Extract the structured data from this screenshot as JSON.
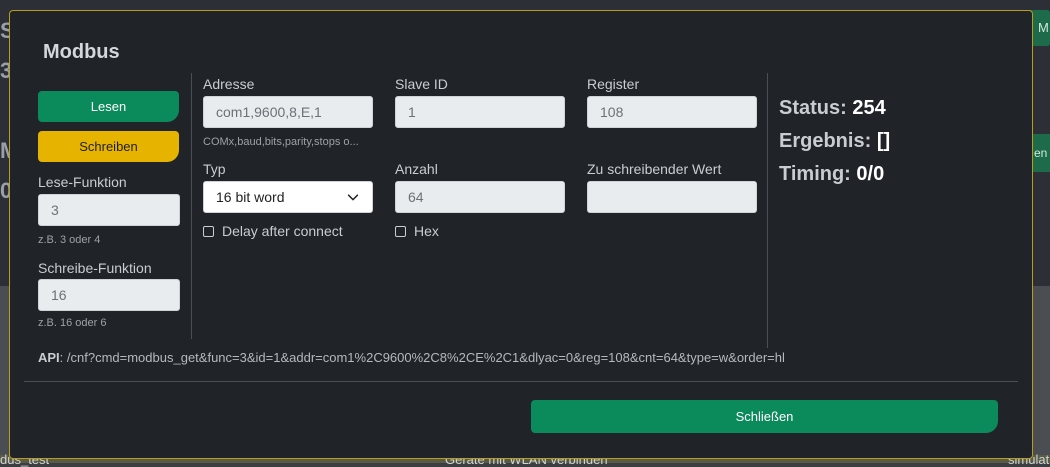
{
  "background": {
    "left_letters": [
      "S",
      "3",
      "M",
      "0"
    ],
    "right_btn1_text": "M",
    "right_btn2_text": "en",
    "bottom_texts": [
      "dus_test",
      "Geräte mit WLAN verbinden",
      "simulati"
    ]
  },
  "modal": {
    "title": "Modbus",
    "buttons": {
      "read": "Lesen",
      "write": "Schreiben",
      "close": "Schließen"
    },
    "read_function": {
      "label": "Lese-Funktion",
      "value": "3",
      "hint": "z.B. 3 oder 4"
    },
    "write_function": {
      "label": "Schreibe-Funktion",
      "value": "16",
      "hint": "z.B. 16 oder 6"
    },
    "address": {
      "label": "Adresse",
      "value": "com1,9600,8,E,1",
      "hint": "COMx,baud,bits,parity,stops o..."
    },
    "slave_id": {
      "label": "Slave ID",
      "value": "1"
    },
    "register": {
      "label": "Register",
      "value": "108"
    },
    "type": {
      "label": "Typ",
      "value": "16 bit word"
    },
    "count": {
      "label": "Anzahl",
      "value": "64"
    },
    "write_value": {
      "label": "Zu schreibender Wert",
      "value": ""
    },
    "delay_checkbox": {
      "label": "Delay after connect",
      "checked": false
    },
    "hex_checkbox": {
      "label": "Hex",
      "checked": false
    },
    "status": {
      "status_label": "Status:",
      "status_value": "254",
      "result_label": "Ergebnis:",
      "result_value": "[]",
      "timing_label": "Timing:",
      "timing_value": "0/0"
    },
    "api": {
      "label": "API",
      "url": ": /cnf?cmd=modbus_get&func=3&id=1&addr=com1%2C9600%2C8%2CE%2C1&dlyac=0&reg=108&cnt=64&type=w&order=hl"
    }
  },
  "colors": {
    "accent_green": "#0b8a5b",
    "accent_yellow": "#e6b400",
    "modal_border": "#b99d1c"
  }
}
